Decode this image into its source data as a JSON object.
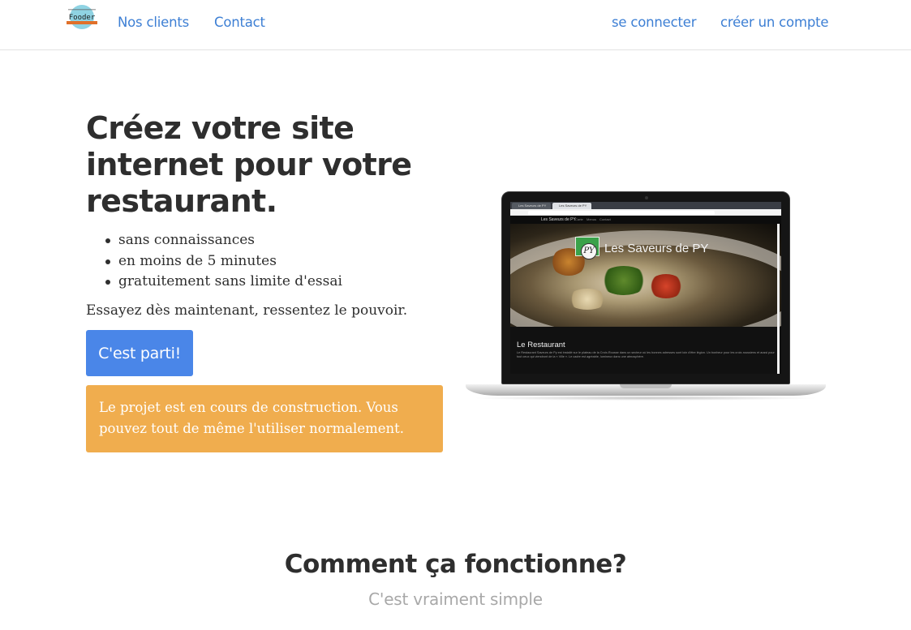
{
  "nav": {
    "logo_text": "Fooder",
    "links": [
      "Nos clients",
      "Contact"
    ],
    "login": "se connecter",
    "signup": "créer un compte"
  },
  "hero": {
    "title": "Créez votre site internet pour votre restaurant.",
    "features": [
      "sans connaissances",
      "en moins de 5 minutes",
      "gratuitement sans limite d'essai"
    ],
    "tagline": "Essayez dès maintenant, ressentez le pouvoir.",
    "cta": "C'est parti!",
    "alert": "Le projet est en cours de construction. Vous pouvez tout de même l'utiliser normalement."
  },
  "preview": {
    "tab1": "Les Saveurs de PY",
    "tab2": "Les Saveurs de PY",
    "nav_brand": "Les Saveurs de PY",
    "nav_items": [
      "Carte",
      "Menus",
      "Contact"
    ],
    "banner_title": "Les Saveurs de PY",
    "seal": "PY",
    "section_title": "Le Restaurant",
    "section_text": "Le Restaurant Saveurs de Py est installé sur le plateau de la Croix-Rousse dans un secteur où les bonnes adresses sont loin d'être légion. Un bonheur pour les croix-roussiens et aussi pour tout ceux qui viendront de la « Ville ». Le cadre est agréable, lumineux dans une atmosphère."
  },
  "how": {
    "title": "Comment ça fonctionne?",
    "subtitle": "C'est vraiment simple"
  },
  "colors": {
    "link": "#3d7fd4",
    "primary_button": "#4a86e8",
    "warning": "#f0ad4e"
  }
}
